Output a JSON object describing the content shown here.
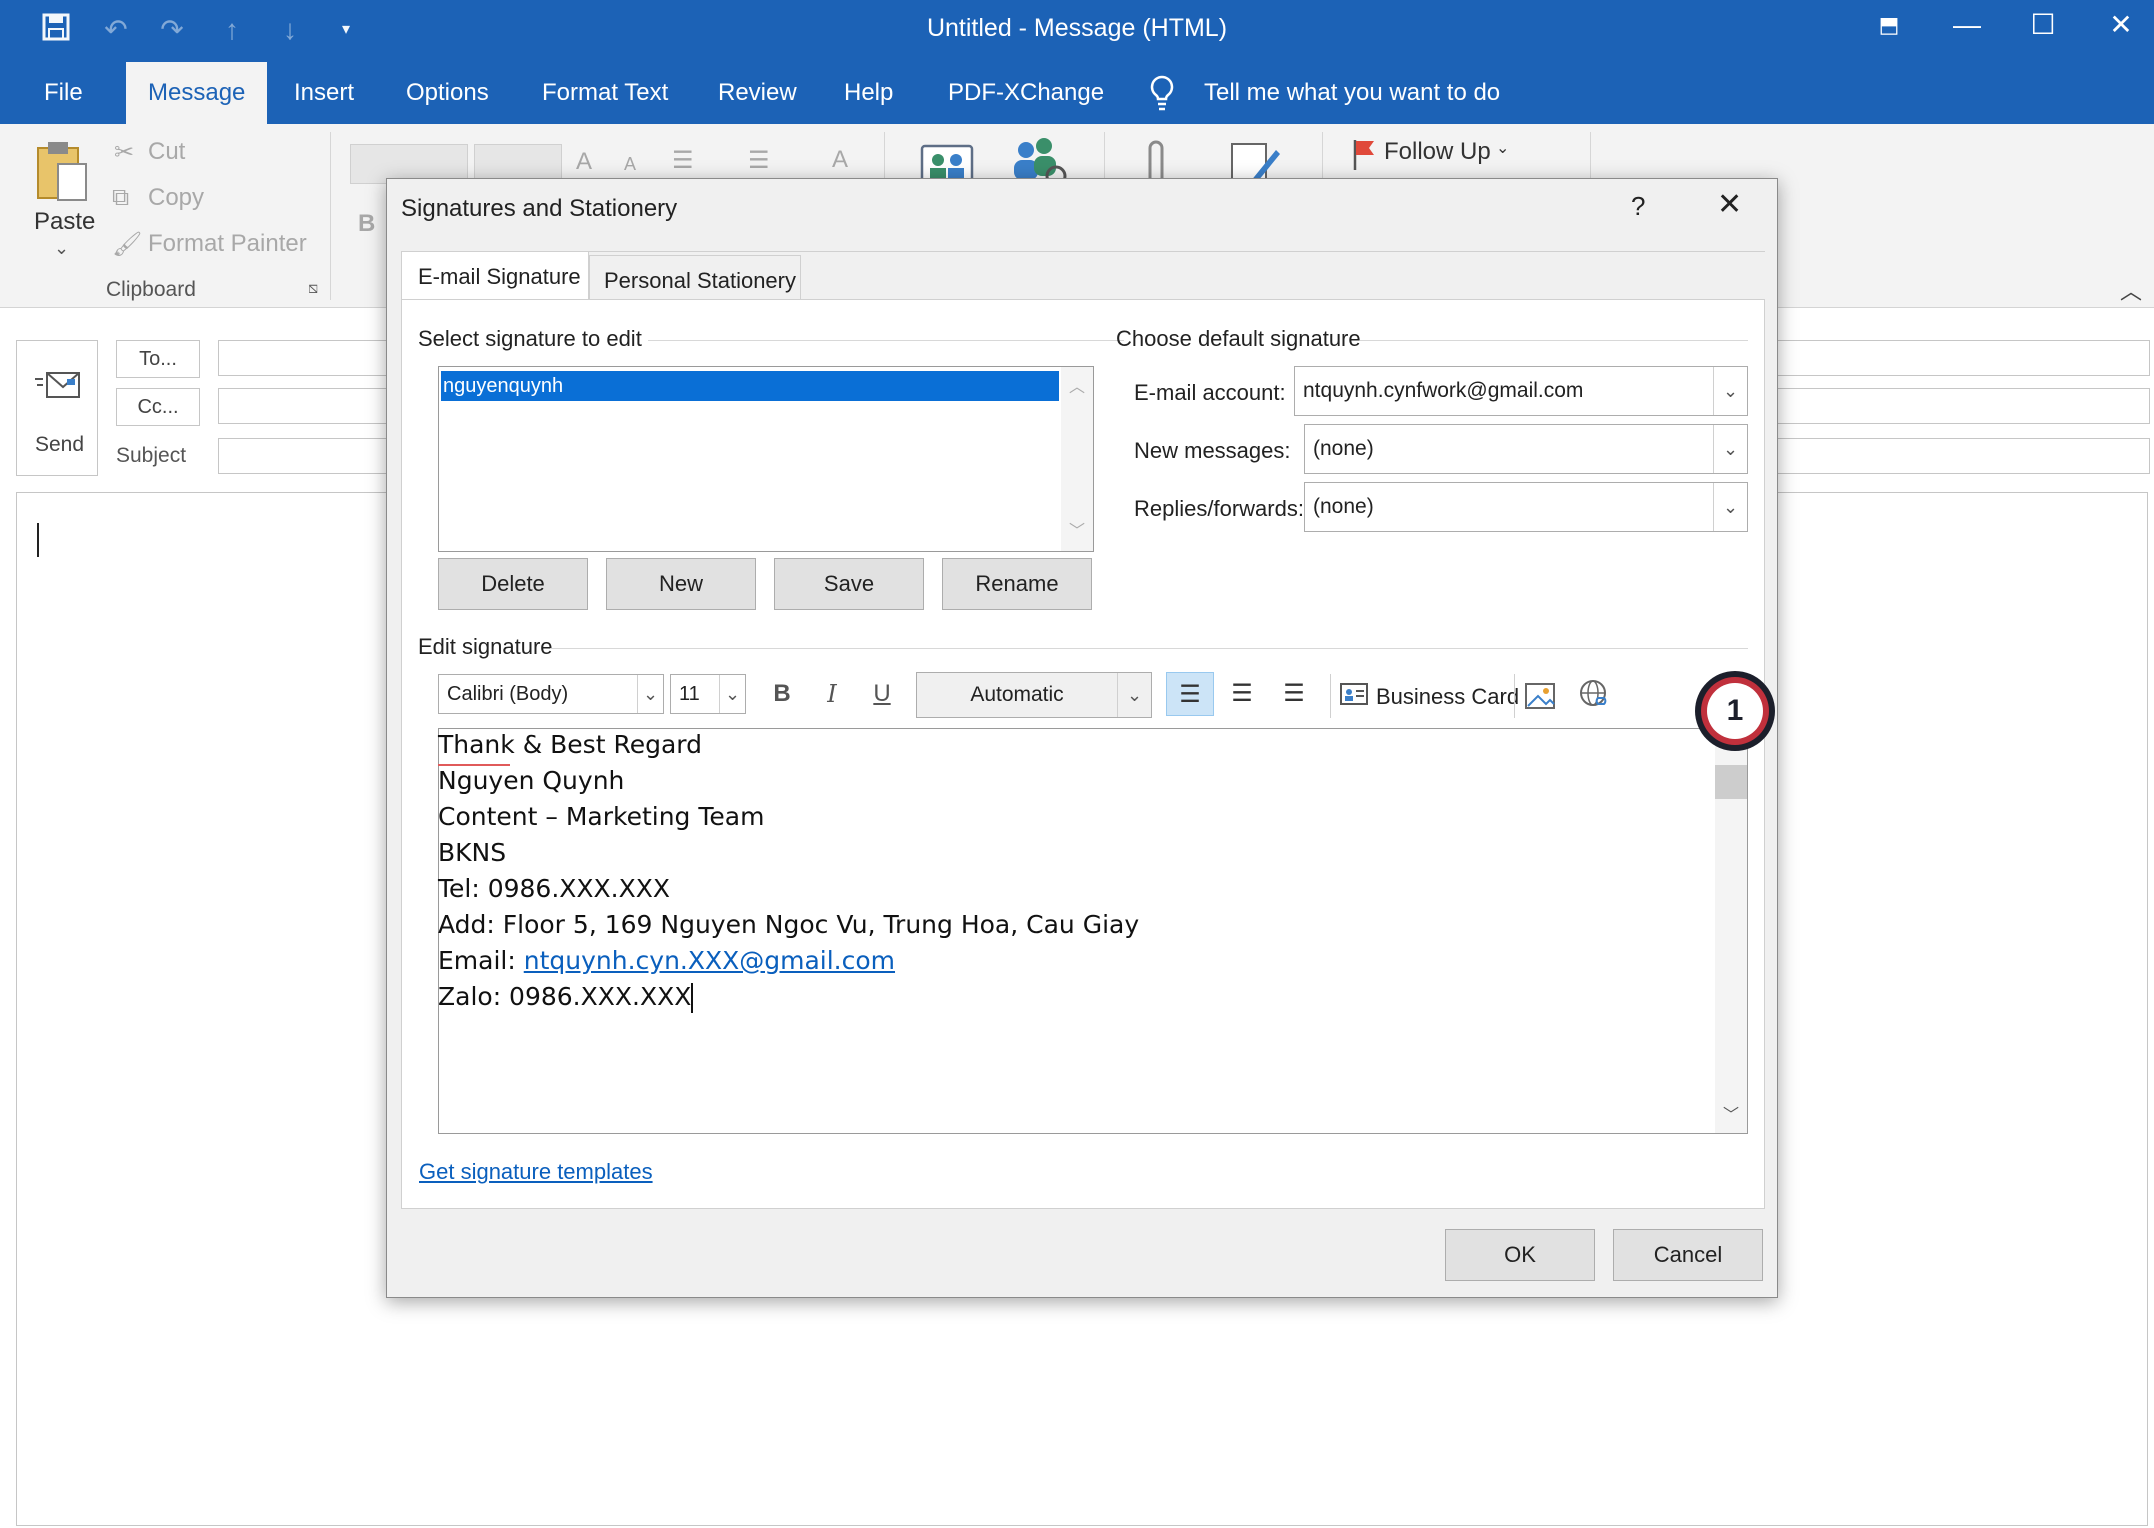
{
  "window": {
    "title": "Untitled  -  Message (HTML)",
    "tabs": [
      "File",
      "Message",
      "Insert",
      "Options",
      "Format Text",
      "Review",
      "Help",
      "PDF-XChange"
    ],
    "tell_me": "Tell me what you want to do",
    "accent": "#1c62b6"
  },
  "ribbon": {
    "paste": "Paste",
    "cut": "Cut",
    "copy": "Copy",
    "format_painter": "Format Painter",
    "clipboard_group": "Clipboard",
    "follow_up": "Follow Up",
    "bold": "B"
  },
  "compose": {
    "send": "Send",
    "to": "To...",
    "cc": "Cc...",
    "subject": "Subject"
  },
  "dialog": {
    "title": "Signatures and Stationery",
    "help": "?",
    "tabs": [
      "E-mail Signature",
      "Personal Stationery"
    ],
    "select_label": "Select signature to edit",
    "signatures": [
      "nguyenquynh"
    ],
    "buttons": {
      "delete": "Delete",
      "new": "New",
      "save": "Save",
      "rename": "Rename"
    },
    "default_label": "Choose default signature",
    "email_account_label": "E-mail account:",
    "email_account": "ntquynh.cynfwork@gmail.com",
    "new_messages_label": "New messages:",
    "new_messages": "(none)",
    "replies_label": "Replies/forwards:",
    "replies": "(none)",
    "edit_label": "Edit signature",
    "font": "Calibri (Body)",
    "size": "11",
    "color": "Automatic",
    "business_card": "Business Card",
    "badge": "1",
    "badge_color": "#c0303c",
    "signature_lines": [
      "Thank & Best Regard",
      "Nguyen Quynh",
      "Content – Marketing Team",
      "BKNS",
      "Tel: 0986.XXX.XXX",
      "Add: Floor 5, 169 Nguyen Ngoc Vu, Trung Hoa, Cau Giay"
    ],
    "email_prefix": "Email: ",
    "email_link": "ntquynh.cyn.XXX@gmail.com",
    "zalo": "Zalo: 0986.XXX.XXX",
    "templates_link": "Get signature templates",
    "ok": "OK",
    "cancel": "Cancel"
  }
}
